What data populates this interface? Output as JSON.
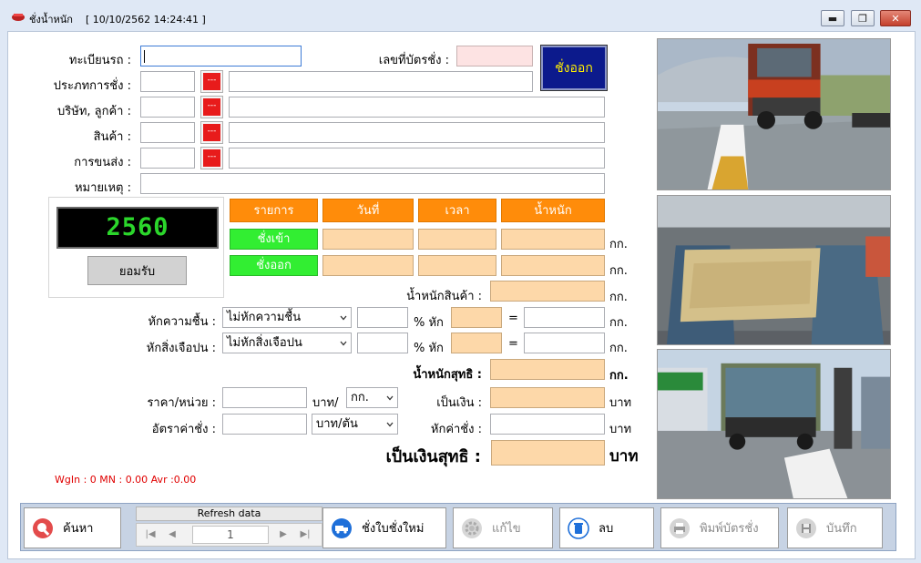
{
  "window": {
    "title": "ชั่งน้ำหนัก",
    "datetime": "[ 10/10/2562   14:24:41 ]",
    "controls": {
      "minimize": "▬",
      "maximize": "❐",
      "close": "✕"
    }
  },
  "form": {
    "plate_label": "ทะเบียนรถ :",
    "plate_value": "",
    "ticket_label": "เลขที่บัตรชั่ง :",
    "ticket_value": "",
    "weigh_type_label": "ประภทการชั่ง :",
    "company_label": "บริษัท, ลูกค้า :",
    "product_label": "สินค้า :",
    "transport_label": "การขนส่ง :",
    "remark_label": "หมายเหตุ :",
    "lookup_btn": "---",
    "weigh_out_button": "ชั่งออก"
  },
  "scale": {
    "reading": "2560",
    "accept_button": "ยอมรับ"
  },
  "grid": {
    "headers": [
      "รายการ",
      "วันที่",
      "เวลา",
      "น้ำหนัก"
    ],
    "rows": [
      {
        "label": "ชั่งเข้า",
        "date": "",
        "time": "",
        "weight": "",
        "unit": "กก."
      },
      {
        "label": "ชั่งออก",
        "date": "",
        "time": "",
        "weight": "",
        "unit": "กก."
      }
    ]
  },
  "calc": {
    "product_weight_label": "น้ำหนักสินค้า :",
    "moisture_label": "หักความชื้น :",
    "moisture_option": "ไม่หักความชื้น",
    "impurity_label": "หักสิ่งเจือปน :",
    "impurity_option": "ไม่หักสิ่งเจือปน",
    "percent_deduct": "% หัก",
    "equals": "=",
    "net_weight_label": "น้ำหนักสุทธิ :",
    "price_label": "ราคา/หน่วย :",
    "price_unit": "บาท/",
    "price_unit_option": "กก.",
    "amount_label": "เป็นเงิน :",
    "rate_label": "อัตราค่าชั่ง :",
    "rate_option": "บาท/ตัน",
    "fee_label": "หักค่าชั่ง :",
    "net_amount_label": "เป็นเงินสุทธิ :",
    "kg": "กก.",
    "baht": "บาท"
  },
  "status": "WgIn : 0    MN : 0.00    Avr :0.00",
  "toolbar": {
    "search": "ค้นหา",
    "refresh": "Refresh data",
    "page": "1",
    "new_ticket": "ชั่งใบชั่งใหม่",
    "edit": "แก้ไข",
    "delete": "ลบ",
    "print": "พิมพ์บัตรชั่ง",
    "save": "บันทึก"
  },
  "colors": {
    "header_orange": "#ff8c0a",
    "row_green": "#32ee32",
    "peach": "#fdd8a9",
    "alert_red": "#e81b1b",
    "lcd_green": "#2bd62b",
    "navy_button": "#0c1a8c"
  }
}
